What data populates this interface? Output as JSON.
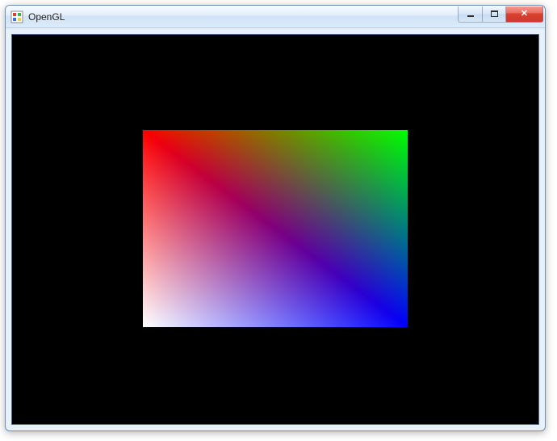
{
  "window": {
    "title": "OpenGL",
    "controls": {
      "minimize_label": "Minimize",
      "maximize_label": "Maximize",
      "close_label": "Close"
    },
    "icon": "opengl-app-icon"
  },
  "viewport": {
    "background_color": "#000000"
  },
  "gl_quad": {
    "corner_colors": {
      "top_left": "#ff0000",
      "top_right": "#00ff00",
      "bottom_right": "#0000ff",
      "bottom_left": "#ffffff"
    }
  }
}
